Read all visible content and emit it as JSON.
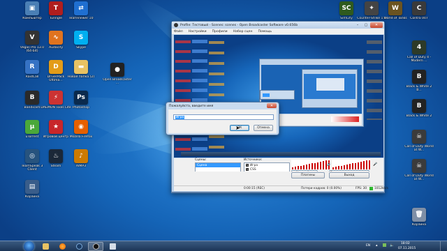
{
  "desktop_icons": [
    {
      "id": "computer",
      "label": "Компьютер",
      "color": "#4a7fb5",
      "glyph": "▣"
    },
    {
      "id": "tunngle",
      "label": "Tunngle",
      "color": "#b01e1e",
      "glyph": "T"
    },
    {
      "id": "teamviewer",
      "label": "TeamViewer 10",
      "color": "#1f6fd1",
      "glyph": "⇄"
    },
    {
      "id": "vegas",
      "label": "Vegas Pro 13.0 (64-bit)",
      "color": "#333333",
      "glyph": "V"
    },
    {
      "id": "audacity",
      "label": "Audacity",
      "color": "#e0731f",
      "glyph": "∿"
    },
    {
      "id": "skype",
      "label": "Skype",
      "color": "#00aff0",
      "glyph": "S"
    },
    {
      "id": "radcall",
      "label": "RaidCall",
      "color": "#3572c4",
      "glyph": "R"
    },
    {
      "id": "driverpack",
      "label": "DriverPack Ultima...",
      "color": "#e39c18",
      "glyph": "D"
    },
    {
      "id": "hinaa",
      "label": "Новая папка (2)",
      "color": "#e8c263",
      "glyph": "▬"
    },
    {
      "id": "obs",
      "label": "Open Broadcaster ...",
      "color": "#222222",
      "glyph": "●"
    },
    {
      "id": "bandicam",
      "label": "Bandicam",
      "color": "#2a2a2a",
      "glyph": "B"
    },
    {
      "id": "adobe-app",
      "label": "DAEMON Tools Lite",
      "color": "#cc3333",
      "glyph": "⚡"
    },
    {
      "id": "photoshop",
      "label": "Photoshop",
      "color": "#0a2a4d",
      "glyph": "Ps"
    },
    {
      "id": "utorrent",
      "label": "uTorrent",
      "color": "#4aa83a",
      "glyph": "µ"
    },
    {
      "id": "gamecenter",
      "label": "Игровой центр",
      "color": "#c8262a",
      "glyph": "★"
    },
    {
      "id": "firefox",
      "label": "Mozilla Firefox",
      "color": "#e66000",
      "glyph": "◉"
    },
    {
      "id": "teamspeak",
      "label": "TeamSpeak 3 Client",
      "color": "#27537e",
      "glyph": "◎"
    },
    {
      "id": "steam",
      "label": "Steam",
      "color": "#1b2838",
      "glyph": "♨"
    },
    {
      "id": "aimp",
      "label": "AIMP3",
      "color": "#cc7a00",
      "glyph": "♪"
    },
    {
      "id": "explorer",
      "label": "Корзина",
      "color": "#395d8a",
      "glyph": "▤"
    },
    {
      "id": "simcity",
      "label": "SimCity",
      "color": "#2f5a1e",
      "glyph": "SC"
    },
    {
      "id": "cs",
      "label": "Counter-Strike 1.6",
      "color": "#444444",
      "glyph": "✦"
    },
    {
      "id": "wot",
      "label": "World of Tanks",
      "color": "#6b5320",
      "glyph": "W"
    },
    {
      "id": "contra",
      "label": "Contra 007",
      "color": "#3a3a3a",
      "glyph": "C"
    },
    {
      "id": "cod4",
      "label": "Call of Duty 4 - Modern ...",
      "color": "#2d3a28",
      "glyph": "4"
    },
    {
      "id": "blackwhite2a",
      "label": "Black & White 2 B...",
      "color": "#222222",
      "glyph": "B"
    },
    {
      "id": "blackwhite2b",
      "label": "Black & White 2",
      "color": "#222222",
      "glyph": "B"
    },
    {
      "id": "codwaw",
      "label": "Call of Duty World at W...",
      "color": "#3b3b3b",
      "glyph": "☠"
    },
    {
      "id": "codwaw2",
      "label": "Call of Duty World at W...",
      "color": "#3b3b3b",
      "glyph": "☠"
    },
    {
      "id": "recycle",
      "label": "Корзина",
      "color": "#7f8fa6",
      "glyph": "🗑"
    }
  ],
  "obs": {
    "title": "Profile: Тестовый - Scenes: scenes - Open Broadcaster Software v0.656b",
    "menu": [
      "Файл",
      "Настройки",
      "Профили",
      "Набор сцен",
      "Помощь"
    ],
    "scenes_label": "Сцены:",
    "scenes": [
      "Сцена"
    ],
    "sources_label": "Источники:",
    "sources": [
      "Игра",
      "CSS",
      "Рабочий стол"
    ],
    "buttons": {
      "settings": "Настройки",
      "start_stream": "Запустить трансляцию",
      "edit_scene": "Изменение сцены",
      "start_record": "Начать запись",
      "global_sources": "Общие источники",
      "preview": "Предпросмотр",
      "plugins": "Плагины",
      "exit": "Выход"
    },
    "status": {
      "time": "0:00:15 (REC)",
      "dropped": "Потери кадров: 0 (0.00%)",
      "fps": "FPS: 30",
      "bitrate": "1012kb/s"
    }
  },
  "dialog": {
    "title": "Пожалуйста, введите имя",
    "close": "✕",
    "value": "Игра",
    "ok": "ОК",
    "cancel": "Отмена"
  },
  "taskbar": {
    "lang": "EN",
    "time": "18:02",
    "date": "07.11.2015"
  }
}
